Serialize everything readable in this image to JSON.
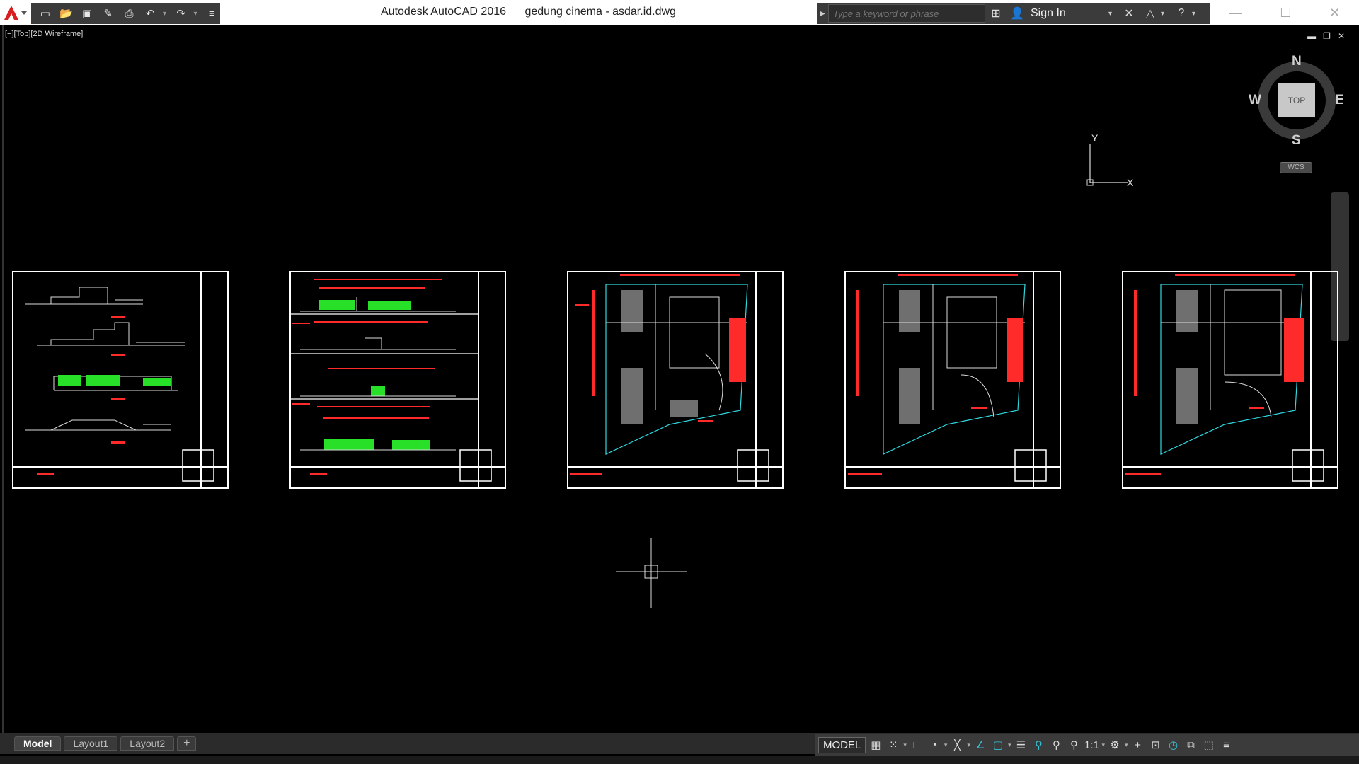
{
  "titlebar": {
    "app_name": "Autodesk AutoCAD 2016",
    "file_name": "gedung cinema - asdar.id.dwg",
    "search_placeholder": "Type a keyword or phrase",
    "sign_in": "Sign In"
  },
  "quick_access": [
    "new-icon",
    "open-icon",
    "save-icon",
    "save-as-icon",
    "plot-icon",
    "undo-icon",
    "redo-icon",
    "workspace-dropdown-icon"
  ],
  "viewport": {
    "label": "[−][Top][2D Wireframe]",
    "controls": [
      "▬",
      "❐",
      "✕"
    ]
  },
  "viewcube": {
    "top_face": "TOP",
    "north": "N",
    "south": "S",
    "east": "E",
    "west": "W",
    "wcs": "WCS"
  },
  "ucs": {
    "x": "X",
    "y": "Y"
  },
  "layout_tabs": [
    "Model",
    "Layout1",
    "Layout2",
    "+"
  ],
  "status_bar": {
    "model": "MODEL",
    "scale": "1:1",
    "icons": [
      "grid-icon",
      "snap-icon",
      "ortho-icon",
      "polar-icon",
      "osnap-icon",
      "otrack-icon",
      "lineweight-icon",
      "annotation-icon",
      "workspace-icon",
      "customize-icon"
    ]
  },
  "colors": {
    "background": "#000000",
    "sheet_border": "#ffffff",
    "drawing_red": "#ff2a2a",
    "drawing_green": "#28e028",
    "drawing_cyan": "#30d8e0"
  }
}
